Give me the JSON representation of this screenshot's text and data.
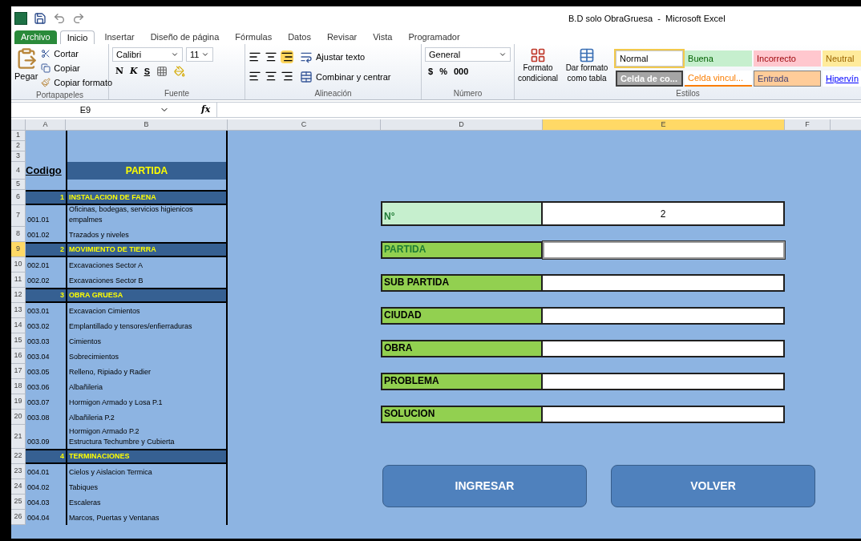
{
  "window": {
    "title": "B.D solo ObraGruesa  -  Microsoft Excel"
  },
  "ribbon_tabs": [
    {
      "label": "Archivo",
      "kind": "file",
      "selected": false
    },
    {
      "label": "Inicio",
      "kind": "tab",
      "selected": true
    },
    {
      "label": "Insertar",
      "kind": "tab",
      "selected": false
    },
    {
      "label": "Diseño de página",
      "kind": "tab",
      "selected": false
    },
    {
      "label": "Fórmulas",
      "kind": "tab",
      "selected": false
    },
    {
      "label": "Datos",
      "kind": "tab",
      "selected": false
    },
    {
      "label": "Revisar",
      "kind": "tab",
      "selected": false
    },
    {
      "label": "Vista",
      "kind": "tab",
      "selected": false
    },
    {
      "label": "Programador",
      "kind": "tab",
      "selected": false
    }
  ],
  "clipboard": {
    "paste": "Pegar",
    "cut": "Cortar",
    "copy": "Copiar",
    "format_painter": "Copiar formato",
    "label": "Portapapeles"
  },
  "font": {
    "name": "Calibri",
    "size": "11",
    "bold": "N",
    "italic": "K",
    "underline": "S",
    "label": "Fuente"
  },
  "alignment": {
    "wrap_text": "Ajustar texto",
    "merge": "Combinar y centrar",
    "label": "Alineación"
  },
  "number": {
    "format": "General",
    "currency": "$",
    "percent": "%",
    "thousands": "000",
    "label": "Número"
  },
  "styles": {
    "conditional": "Formato\ncondicional",
    "as_table": "Dar formato\ncomo tabla",
    "label": "Estilos"
  },
  "cell_styles": [
    {
      "label": "Normal",
      "kind": "normal",
      "selected": true
    },
    {
      "label": "Buena",
      "kind": "good",
      "selected": false
    },
    {
      "label": "Incorrecto",
      "kind": "bad",
      "selected": false
    },
    {
      "label": "Neutral",
      "kind": "neutral",
      "selected": false
    },
    {
      "label": "Celda de co...",
      "kind": "check",
      "selected": false
    },
    {
      "label": "Celda vincul...",
      "kind": "linked",
      "selected": false
    },
    {
      "label": "Entrada",
      "kind": "input",
      "selected": false
    },
    {
      "label": "Hipervín",
      "kind": "link",
      "selected": false
    }
  ],
  "formula_bar": {
    "name_box": "E9",
    "fx": "fx"
  },
  "columns": [
    {
      "label": "A",
      "selected": false
    },
    {
      "label": "B",
      "selected": false
    },
    {
      "label": "C",
      "selected": false
    },
    {
      "label": "D",
      "selected": false
    },
    {
      "label": "E",
      "selected": true
    },
    {
      "label": "F",
      "selected": false
    }
  ],
  "rows": [
    {
      "number": "1",
      "kind": "blank",
      "selected": false
    },
    {
      "number": "2",
      "kind": "blank",
      "selected": false
    },
    {
      "number": "3",
      "kind": "blank",
      "selected": false
    },
    {
      "number": "4",
      "kind": "header",
      "code": "Codigo",
      "partida": "PARTIDA",
      "selected": false
    },
    {
      "number": "5",
      "kind": "blank",
      "selected": false
    },
    {
      "number": "6",
      "kind": "section",
      "code": "1",
      "partida": "INSTALACION DE FAENA",
      "selected": false
    },
    {
      "number": "7",
      "kind": "item",
      "code": "001.01",
      "partida": "Oficinas, bodegas, servicios higienicos empalmes",
      "selected": false
    },
    {
      "number": "8",
      "kind": "item",
      "code": "001.02",
      "partida": "Trazados y niveles",
      "selected": false
    },
    {
      "number": "9",
      "kind": "section",
      "code": "2",
      "partida": "MOVIMIENTO DE TIERRA",
      "selected": true
    },
    {
      "number": "10",
      "kind": "item",
      "code": "002.01",
      "partida": "Excavaciones Sector A",
      "selected": false
    },
    {
      "number": "11",
      "kind": "item",
      "code": "002.02",
      "partida": "Excavaciones Sector B",
      "selected": false
    },
    {
      "number": "12",
      "kind": "section",
      "code": "3",
      "partida": "OBRA GRUESA",
      "selected": false
    },
    {
      "number": "13",
      "kind": "item",
      "code": "003.01",
      "partida": "Excavacion Cimientos",
      "selected": false
    },
    {
      "number": "14",
      "kind": "item",
      "code": "003.02",
      "partida": "Emplantillado y tensores/enfierraduras",
      "selected": false
    },
    {
      "number": "15",
      "kind": "item",
      "code": "003.03",
      "partida": "Cimientos",
      "selected": false
    },
    {
      "number": "16",
      "kind": "item",
      "code": "003.04",
      "partida": "Sobrecimientos",
      "selected": false
    },
    {
      "number": "17",
      "kind": "item",
      "code": "003.05",
      "partida": "Relleno, Ripiado y Radier",
      "selected": false
    },
    {
      "number": "18",
      "kind": "item",
      "code": "003.06",
      "partida": "Albañileria",
      "selected": false
    },
    {
      "number": "19",
      "kind": "item",
      "code": "003.07",
      "partida": "Hormigon Armado y Losa P.1",
      "selected": false
    },
    {
      "number": "20",
      "kind": "item",
      "code": "003.08",
      "partida": "Albañileria P.2",
      "selected": false
    },
    {
      "number": "21",
      "kind": "item",
      "code": "003.09",
      "partida": "Hormigon Armado P.2\nEstructura Techumbre y Cubierta",
      "selected": false
    },
    {
      "number": "22",
      "kind": "section",
      "code": "4",
      "partida": "TERMINACIONES",
      "selected": false
    },
    {
      "number": "23",
      "kind": "item",
      "code": "004.01",
      "partida": "Cielos y Aislacion Termica",
      "selected": false
    },
    {
      "number": "24",
      "kind": "item",
      "code": "004.02",
      "partida": "Tabiques",
      "selected": false
    },
    {
      "number": "25",
      "kind": "item",
      "code": "004.03",
      "partida": "Escaleras",
      "selected": false
    },
    {
      "number": "26",
      "kind": "item",
      "code": "004.04",
      "partida": "Marcos, Puertas y Ventanas",
      "selected": false
    }
  ],
  "form": {
    "fields": [
      {
        "label": "N°",
        "kind": "id",
        "value": "2",
        "color": "#1e7b34",
        "selected": false
      },
      {
        "label": "PARTIDA",
        "kind": "text",
        "color": "#1e7b34",
        "selected": true
      },
      {
        "label": "SUB PARTIDA",
        "kind": "text",
        "color": "#000000",
        "selected": false
      },
      {
        "label": "CIUDAD",
        "kind": "text",
        "color": "#000000",
        "selected": false
      },
      {
        "label": "OBRA",
        "kind": "text",
        "color": "#000000",
        "selected": false
      },
      {
        "label": "PROBLEMA",
        "kind": "text",
        "color": "#000000",
        "selected": false
      },
      {
        "label": "SOLUCION",
        "kind": "text",
        "color": "#000000",
        "selected": false
      }
    ],
    "buttons": [
      "INGRESAR",
      "VOLVER"
    ]
  }
}
